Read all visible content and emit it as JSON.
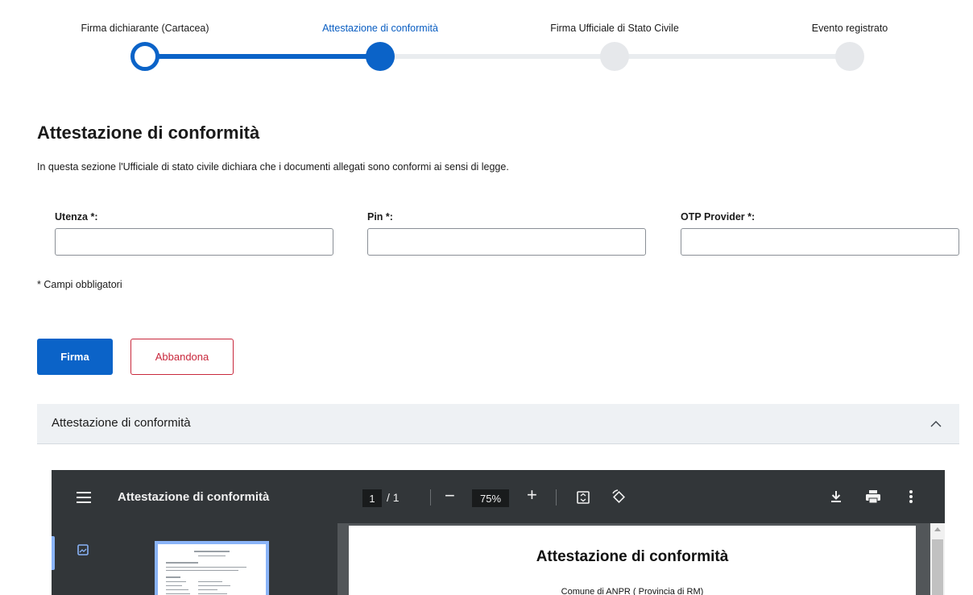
{
  "stepper": {
    "steps": [
      {
        "label": "Firma dichiarante (Cartacea)",
        "state": "done"
      },
      {
        "label": "Attestazione di conformità",
        "state": "current"
      },
      {
        "label": "Firma Ufficiale di Stato Civile",
        "state": "todo"
      },
      {
        "label": "Evento registrato",
        "state": "todo"
      }
    ]
  },
  "section": {
    "title": "Attestazione di conformità",
    "description": "In questa sezione l'Ufficiale di stato civile dichiara che i documenti allegati sono conformi ai sensi di legge."
  },
  "form": {
    "fields": [
      {
        "label": "Utenza *:",
        "value": ""
      },
      {
        "label": "Pin *:",
        "value": ""
      },
      {
        "label": "OTP Provider *:",
        "value": ""
      }
    ],
    "required_note": "* Campi obbligatori"
  },
  "actions": {
    "primary_label": "Firma",
    "secondary_label": "Abbandona"
  },
  "accordion": {
    "title": "Attestazione di conformità"
  },
  "pdf_viewer": {
    "title": "Attestazione di conformità",
    "current_page": "1",
    "page_total": "/ 1",
    "zoom": "75%",
    "document_title": "Attestazione di conformità",
    "document_subtitle": "Comune di ANPR ( Provincia di RM)"
  },
  "colors": {
    "primary": "#0b63c8",
    "danger": "#c8283c",
    "viewer_toolbar": "#323639",
    "viewer_bg": "#525659"
  }
}
